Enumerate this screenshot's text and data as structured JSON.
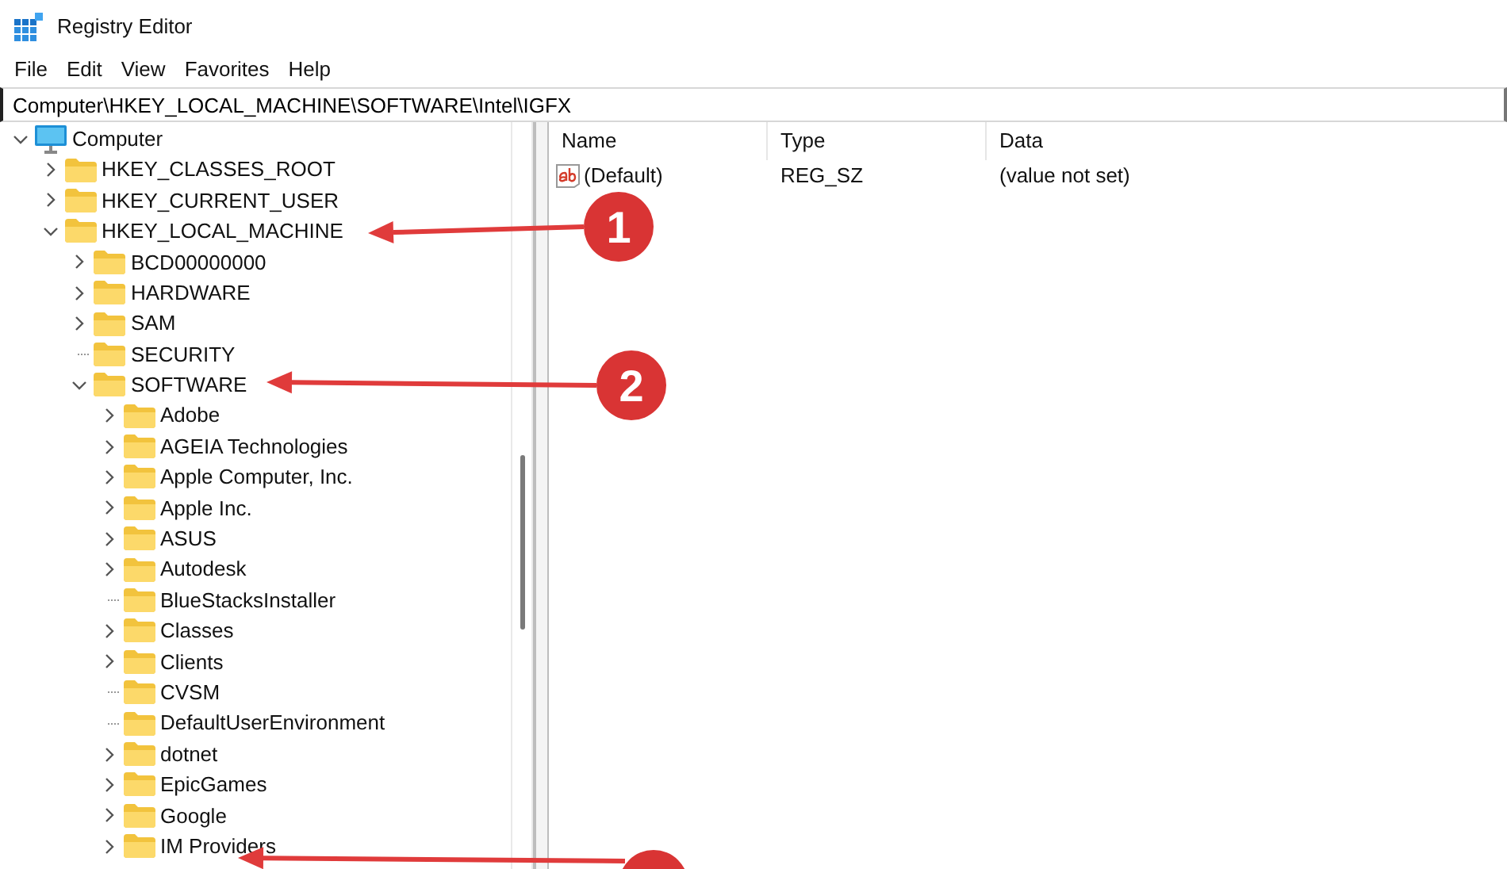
{
  "window": {
    "title": "Registry Editor"
  },
  "menu": [
    "File",
    "Edit",
    "View",
    "Favorites",
    "Help"
  ],
  "address_bar": {
    "value": "Computer\\HKEY_LOCAL_MACHINE\\SOFTWARE\\Intel\\IGFX"
  },
  "tree": [
    {
      "label": "Computer",
      "kind": "computer",
      "expandable": true,
      "expanded": true,
      "children": [
        {
          "label": "HKEY_CLASSES_ROOT",
          "kind": "folder",
          "expandable": true,
          "expanded": false
        },
        {
          "label": "HKEY_CURRENT_USER",
          "kind": "folder",
          "expandable": true,
          "expanded": false
        },
        {
          "label": "HKEY_LOCAL_MACHINE",
          "kind": "folder",
          "expandable": true,
          "expanded": true,
          "children": [
            {
              "label": "BCD00000000",
              "kind": "folder",
              "expandable": true,
              "expanded": false
            },
            {
              "label": "HARDWARE",
              "kind": "folder",
              "expandable": true,
              "expanded": false
            },
            {
              "label": "SAM",
              "kind": "folder",
              "expandable": true,
              "expanded": false
            },
            {
              "label": "SECURITY",
              "kind": "folder",
              "expandable": false,
              "expanded": false
            },
            {
              "label": "SOFTWARE",
              "kind": "folder",
              "expandable": true,
              "expanded": true,
              "children": [
                {
                  "label": "Adobe",
                  "kind": "folder",
                  "expandable": true,
                  "expanded": false
                },
                {
                  "label": "AGEIA Technologies",
                  "kind": "folder",
                  "expandable": true,
                  "expanded": false
                },
                {
                  "label": "Apple Computer, Inc.",
                  "kind": "folder",
                  "expandable": true,
                  "expanded": false
                },
                {
                  "label": "Apple Inc.",
                  "kind": "folder",
                  "expandable": true,
                  "expanded": false
                },
                {
                  "label": "ASUS",
                  "kind": "folder",
                  "expandable": true,
                  "expanded": false
                },
                {
                  "label": "Autodesk",
                  "kind": "folder",
                  "expandable": true,
                  "expanded": false
                },
                {
                  "label": "BlueStacksInstaller",
                  "kind": "folder",
                  "expandable": false,
                  "expanded": false
                },
                {
                  "label": "Classes",
                  "kind": "folder",
                  "expandable": true,
                  "expanded": false
                },
                {
                  "label": "Clients",
                  "kind": "folder",
                  "expandable": true,
                  "expanded": false
                },
                {
                  "label": "CVSM",
                  "kind": "folder",
                  "expandable": false,
                  "expanded": false
                },
                {
                  "label": "DefaultUserEnvironment",
                  "kind": "folder",
                  "expandable": false,
                  "expanded": false
                },
                {
                  "label": "dotnet",
                  "kind": "folder",
                  "expandable": true,
                  "expanded": false
                },
                {
                  "label": "EpicGames",
                  "kind": "folder",
                  "expandable": true,
                  "expanded": false
                },
                {
                  "label": "Google",
                  "kind": "folder",
                  "expandable": true,
                  "expanded": false
                },
                {
                  "label": "IM Providers",
                  "kind": "folder",
                  "expandable": true,
                  "expanded": false
                }
              ]
            }
          ]
        }
      ]
    }
  ],
  "values_table": {
    "columns": [
      "Name",
      "Type",
      "Data"
    ],
    "rows": [
      {
        "name": "(Default)",
        "type": "REG_SZ",
        "data": "(value not set)"
      }
    ]
  },
  "callouts": [
    {
      "kind": "numbered",
      "label": "1"
    },
    {
      "kind": "numbered",
      "label": "2"
    },
    {
      "kind": "cut-off"
    }
  ]
}
